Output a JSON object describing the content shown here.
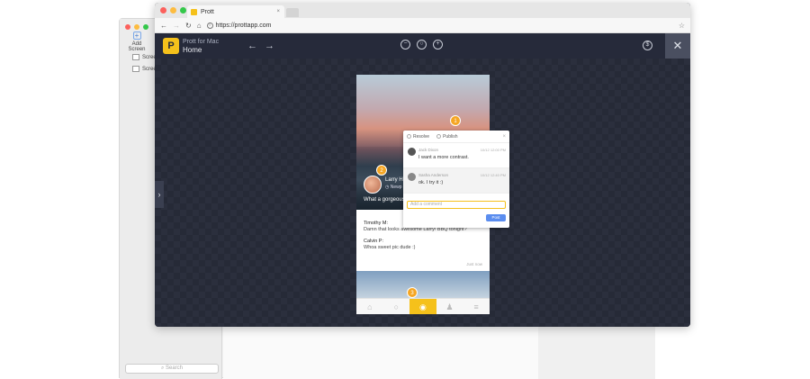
{
  "bg_app": {
    "add_screen_label": "Add Screen",
    "list_items": [
      "Scree",
      "Scree"
    ],
    "search_placeholder": "Search"
  },
  "browser": {
    "tab_title": "Prott",
    "tab_close": "×",
    "url": "https://prottapp.com",
    "colors": {
      "close": "#fc605c",
      "minimize": "#fdbc40",
      "zoom": "#34c84a"
    }
  },
  "app": {
    "title_line1": "Prott for Mac",
    "title_line2": "Home",
    "back_icon": "←",
    "forward_icon": "→",
    "zoom_out_icon": "−",
    "zoom_reset_icon": "○",
    "zoom_in_icon": "+",
    "dollar_icon": "$",
    "close_icon": "✕",
    "logo_glyph": "P",
    "sidebar_toggle_icon": "›",
    "accent": "#f5c11b"
  },
  "screen": {
    "post_name": "Larry Ha",
    "post_sub": "Newp",
    "post_caption": "What a gorgeous",
    "comments": [
      {
        "name": "Timothy M:",
        "text": "Damn that looks awesome Larry! BBQ tonight?"
      },
      {
        "name": "Calvin P:",
        "text": "Whoa sweet pic dude :)"
      }
    ],
    "just_now": "Just now",
    "pins": [
      "1",
      "2",
      "3"
    ],
    "tab_icons": [
      "⌂",
      "○",
      "◉",
      "♟",
      "≡"
    ]
  },
  "popup": {
    "resolve_label": "Resolve",
    "publish_label": "Publish",
    "close": "×",
    "messages": [
      {
        "name": "Jack Dixon",
        "time": "10/12 12:00 PM",
        "text": "I want a more contrast."
      },
      {
        "name": "Sasha Anderson",
        "time": "10/12 12:40 PM",
        "text": "ok. I try it :)"
      }
    ],
    "input_placeholder": "Add a comment",
    "post_button": "Post"
  }
}
